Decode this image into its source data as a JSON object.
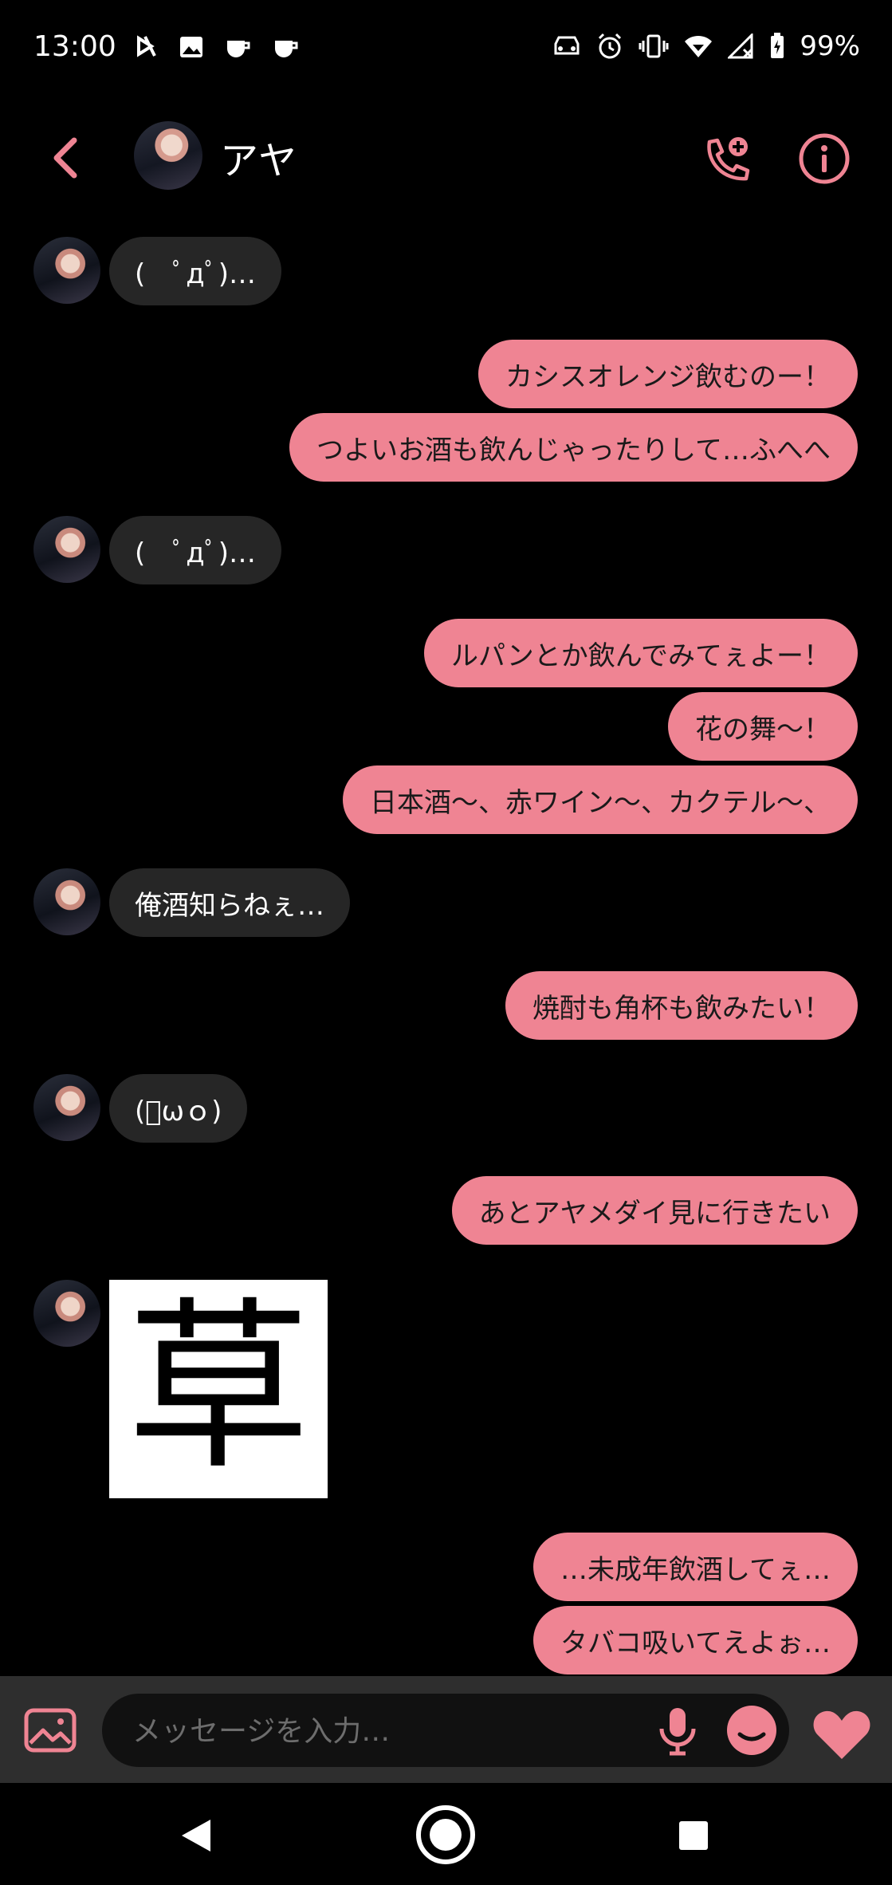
{
  "status_bar": {
    "time": "13:00",
    "battery": "99%",
    "left_icons": [
      "media-icon",
      "image-icon",
      "cup-icon",
      "cup-icon"
    ],
    "right_icons": [
      "car-icon",
      "alarm-icon",
      "vibrate-icon",
      "wifi-icon",
      "signal-icon",
      "battery-icon"
    ]
  },
  "header": {
    "contact_name": "アヤ"
  },
  "messages": [
    {
      "from": "other",
      "text": "(　ﾟдﾟ)…"
    },
    {
      "from": "me",
      "text": "カシスオレンジ飲むのー！"
    },
    {
      "from": "me",
      "text": "つよいお酒も飲んじゃったりして…ふへへ"
    },
    {
      "from": "other",
      "text": "(　ﾟдﾟ)…"
    },
    {
      "from": "me",
      "text": "ルパンとか飲んでみてぇよー！"
    },
    {
      "from": "me",
      "text": "花の舞〜！"
    },
    {
      "from": "me",
      "text": "日本酒〜、赤ワイン〜、カクテル〜、"
    },
    {
      "from": "other",
      "text": "俺酒知らねぇ…"
    },
    {
      "from": "me",
      "text": "焼酎も角杯も飲みたい！"
    },
    {
      "from": "other",
      "text": "(ﾟωｏ)"
    },
    {
      "from": "me",
      "text": "あとアヤメダイ見に行きたい"
    },
    {
      "from": "other",
      "sticker": "草"
    },
    {
      "from": "me",
      "text": "…未成年飲酒してぇ…"
    },
    {
      "from": "me",
      "text": "タバコ吸いてえよぉ…"
    }
  ],
  "composer": {
    "placeholder": "メッセージを入力…"
  },
  "colors": {
    "accent": "#ef8493",
    "received_bubble": "#262626",
    "background": "#000000"
  }
}
